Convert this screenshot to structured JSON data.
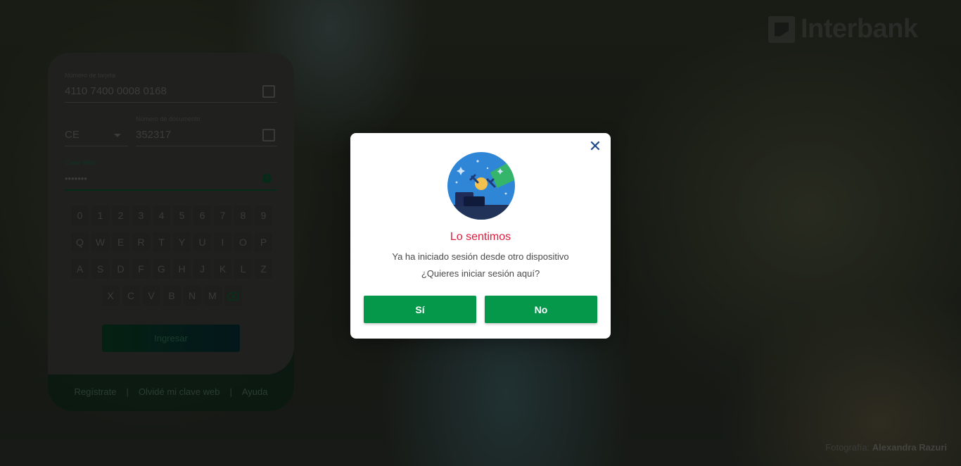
{
  "brand": {
    "logo_text": "Interbank"
  },
  "login": {
    "card_number_label": "Número de tarjeta",
    "card_number_value": "4110 7400 0008 0168",
    "doc_type_value": "CE",
    "doc_number_label": "Número de documento",
    "doc_number_value": "352317",
    "password_label": "Clave Web",
    "password_value": "•••••••",
    "keypad_rows": [
      [
        "0",
        "1",
        "2",
        "3",
        "4",
        "5",
        "6",
        "7",
        "8",
        "9"
      ],
      [
        "Q",
        "W",
        "E",
        "R",
        "T",
        "Y",
        "U",
        "I",
        "O",
        "P"
      ],
      [
        "A",
        "S",
        "D",
        "F",
        "G",
        "H",
        "J",
        "K",
        "L",
        "Z"
      ],
      [
        "X",
        "C",
        "V",
        "B",
        "N",
        "M"
      ]
    ],
    "submit_label": "Ingresar"
  },
  "footer_links": {
    "register": "Regístrate",
    "forgot": "Olvidé mi clave web",
    "help": "Ayuda",
    "separator": "|"
  },
  "credit": {
    "prefix": "Fotografía:",
    "author": "Alexandra Razuri"
  },
  "modal": {
    "title": "Lo sentimos",
    "line1": "Ya ha iniciado sesión desde otro dispositivo",
    "line2": "¿Quieres iniciar sesión aquí?",
    "yes_label": "Sí",
    "no_label": "No",
    "close_icon": "close-icon"
  },
  "colors": {
    "accent_green": "#05984a",
    "title_red": "#e01a3b",
    "close_blue": "#1f4a8a"
  }
}
